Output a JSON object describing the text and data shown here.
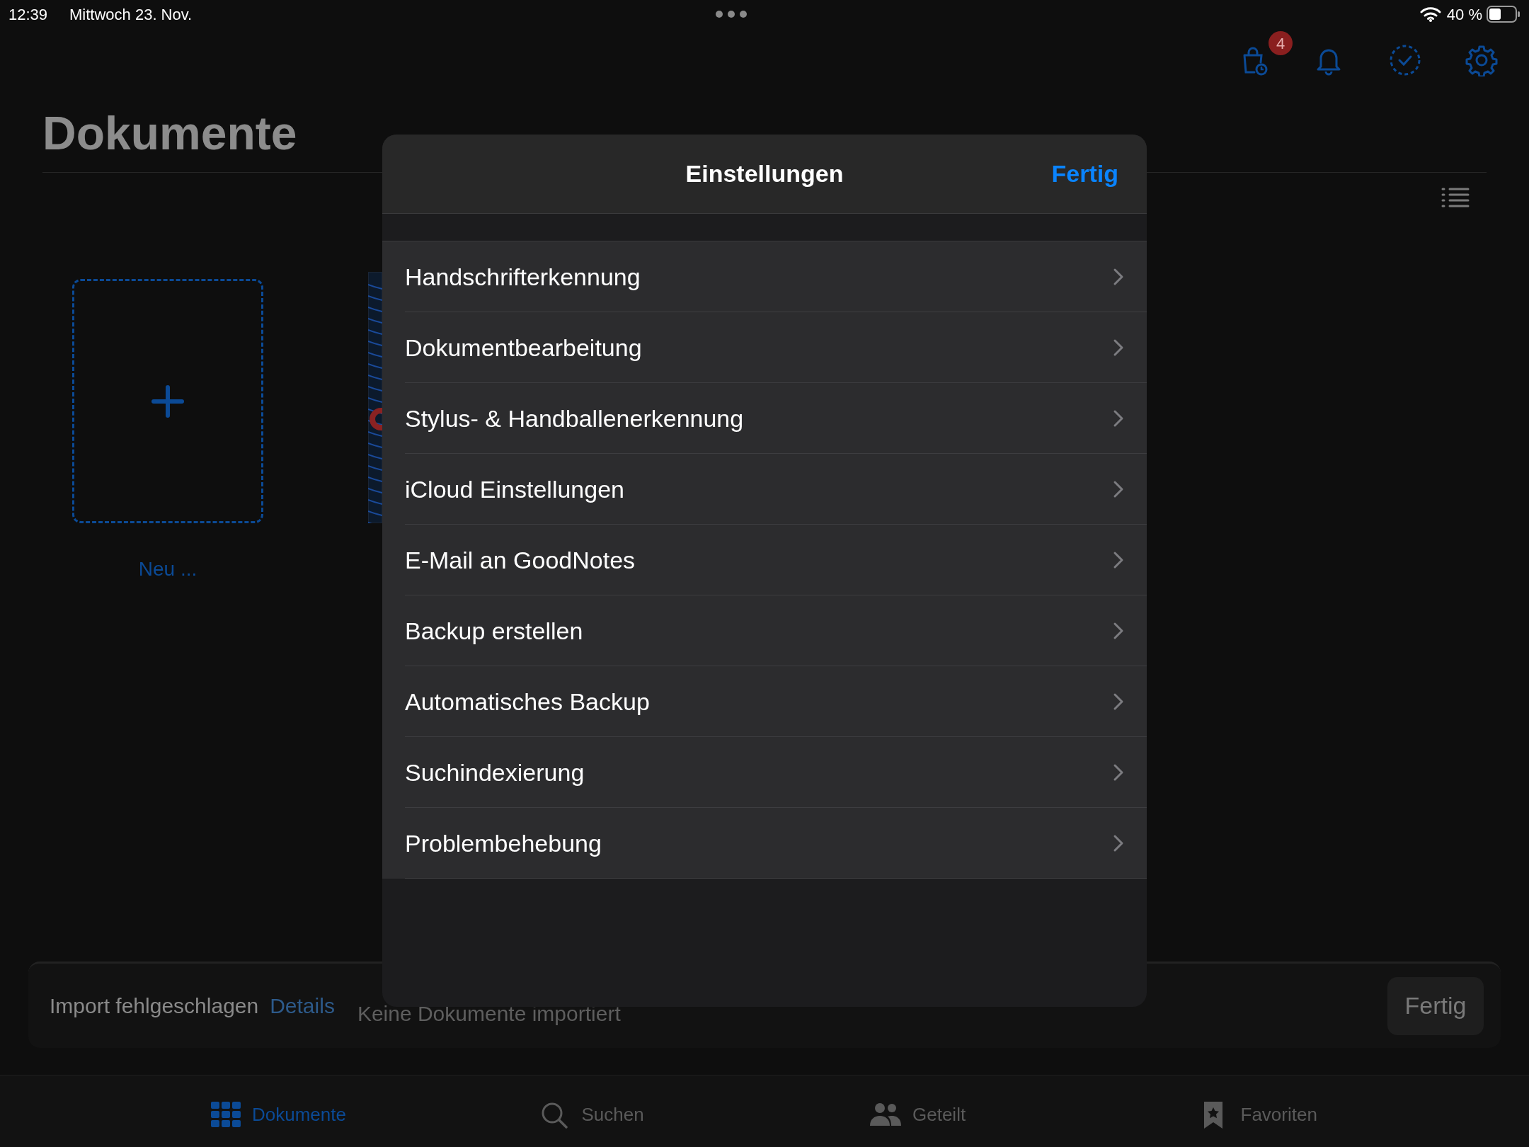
{
  "status_bar": {
    "time": "12:39",
    "date": "Mittwoch 23. Nov.",
    "battery": "40 %"
  },
  "toolbar": {
    "badge": "4"
  },
  "title": "Dokumente",
  "new_document": {
    "label": "Neu ..."
  },
  "import_bar": {
    "message": "Import fehlgeschlagen",
    "link": "Details",
    "detail": "Keine Dokumente importiert",
    "button": "Fertig"
  },
  "tabs": [
    {
      "label": "Dokumente",
      "selected": true
    },
    {
      "label": "Suchen",
      "selected": false
    },
    {
      "label": "Geteilt",
      "selected": false
    },
    {
      "label": "Favoriten",
      "selected": false
    }
  ],
  "modal": {
    "title": "Einstellungen",
    "done": "Fertig",
    "items": [
      {
        "label": "Handschrifterkennung"
      },
      {
        "label": "Dokumentbearbeitung"
      },
      {
        "label": "Stylus- & Handballenerkennung"
      },
      {
        "label": "iCloud Einstellungen"
      },
      {
        "label": "E-Mail an GoodNotes"
      },
      {
        "label": "Backup erstellen"
      },
      {
        "label": "Automatisches Backup"
      },
      {
        "label": "Suchindexierung"
      },
      {
        "label": "Problembehebung"
      }
    ]
  }
}
